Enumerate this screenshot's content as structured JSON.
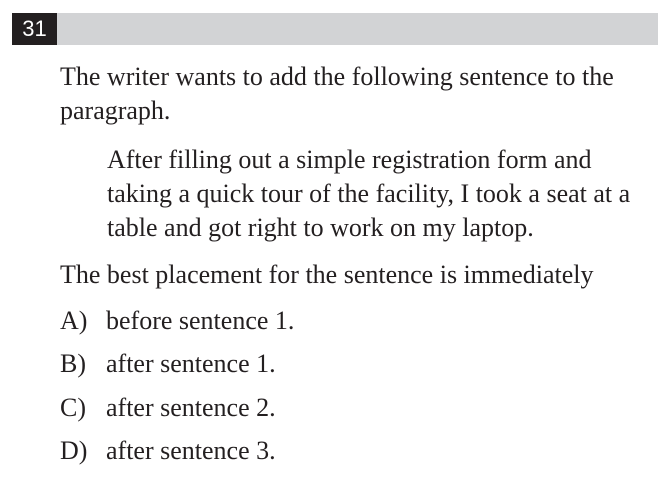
{
  "question": {
    "number": "31",
    "stem": "The writer wants to add the following sentence to the paragraph.",
    "quote": "After filling out a simple registration form and taking a quick tour of the facility, I took a seat at a table and got right to work on my laptop.",
    "prompt": "The best placement for the sentence is immediately",
    "choices": [
      {
        "letter": "A)",
        "text": "before sentence 1."
      },
      {
        "letter": "B)",
        "text": "after sentence 1."
      },
      {
        "letter": "C)",
        "text": "after sentence 2."
      },
      {
        "letter": "D)",
        "text": "after sentence 3."
      }
    ]
  },
  "colors": {
    "header_bar": "#d2d3d5",
    "number_box": "#231f20",
    "text": "#231f20"
  }
}
